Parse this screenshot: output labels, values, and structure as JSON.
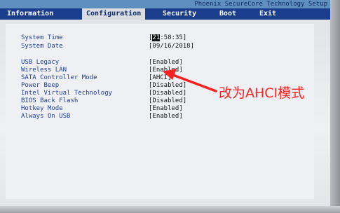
{
  "vendor_title": "Phoenix SecureCore Technology Setup",
  "menu": [
    {
      "label": "Information"
    },
    {
      "label": "Configuration"
    },
    {
      "label": "Security"
    },
    {
      "label": "Boot"
    },
    {
      "label": "Exit"
    }
  ],
  "active_menu": "Configuration",
  "fields": {
    "system_time": {
      "label": "System Time",
      "value_hour": "21",
      "value_rest": ":58:35]"
    },
    "system_date": {
      "label": "System Date",
      "value": "[09/16/2018]"
    },
    "usb_legacy": {
      "label": "USB Legacy",
      "value": "[Enabled]"
    },
    "wireless_lan": {
      "label": "Wireless LAN",
      "value": "[Enabled]"
    },
    "sata_mode": {
      "label": "SATA Controller Mode",
      "value": "[AHCI]"
    },
    "power_beep": {
      "label": "Power Beep",
      "value": "[Disabled]"
    },
    "intel_vt": {
      "label": "Intel Virtual Technology",
      "value": "[Disabled]"
    },
    "bios_back_flash": {
      "label": "BIOS Back Flash",
      "value": "[Disabled]"
    },
    "hotkey_mode": {
      "label": "Hotkey Mode",
      "value": "[Enabled]"
    },
    "always_on_usb": {
      "label": "Always On USB",
      "value": "[Enabled]"
    }
  },
  "annotation_text": "改为AHCI模式",
  "colors": {
    "menu_bar": "#1a3d8e",
    "label_blue": "#1f3f9a",
    "annotation_red": "#ff2222"
  }
}
